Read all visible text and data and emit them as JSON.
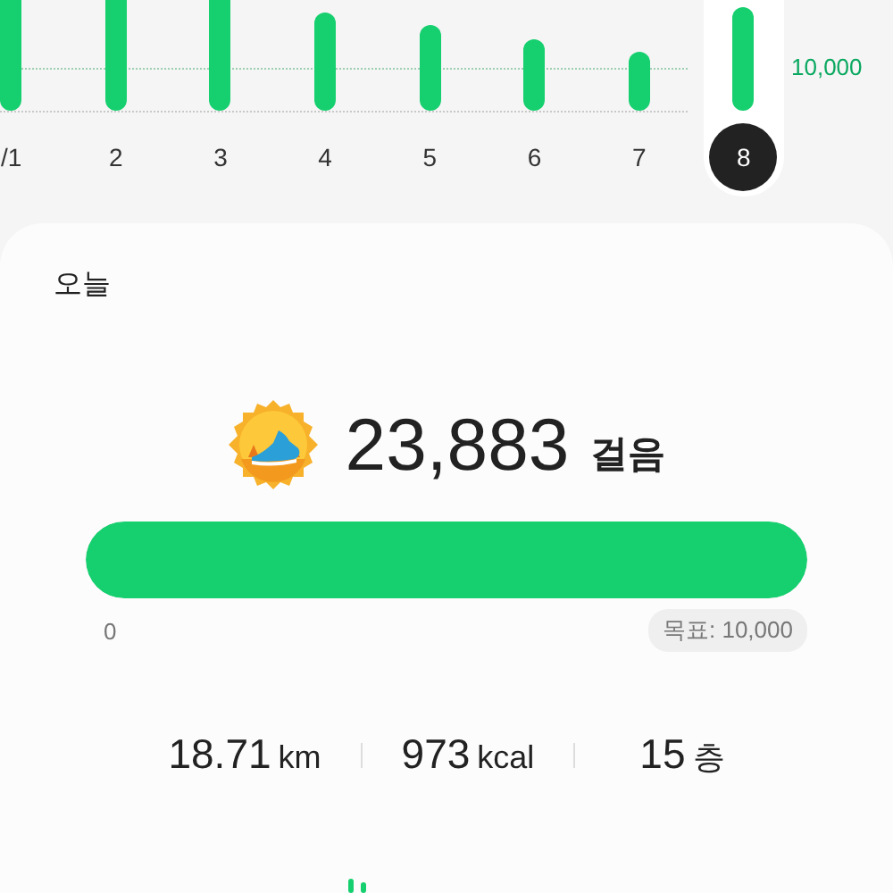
{
  "chart": {
    "goal_label": "10,000",
    "days": [
      {
        "label": "/1",
        "selected": false
      },
      {
        "label": "2",
        "selected": false
      },
      {
        "label": "3",
        "selected": false
      },
      {
        "label": "4",
        "selected": false
      },
      {
        "label": "5",
        "selected": false
      },
      {
        "label": "6",
        "selected": false
      },
      {
        "label": "7",
        "selected": false
      },
      {
        "label": "8",
        "selected": true
      }
    ]
  },
  "today": {
    "title": "오늘",
    "steps": "23,883",
    "steps_unit": "걸음",
    "level": 1,
    "min_label": "0",
    "goal": "목표: 10,000",
    "stats": [
      {
        "value": "18.71",
        "unit": "km"
      },
      {
        "value": "973",
        "unit": "kcal"
      },
      {
        "value": "15",
        "unit": "층"
      }
    ]
  }
}
